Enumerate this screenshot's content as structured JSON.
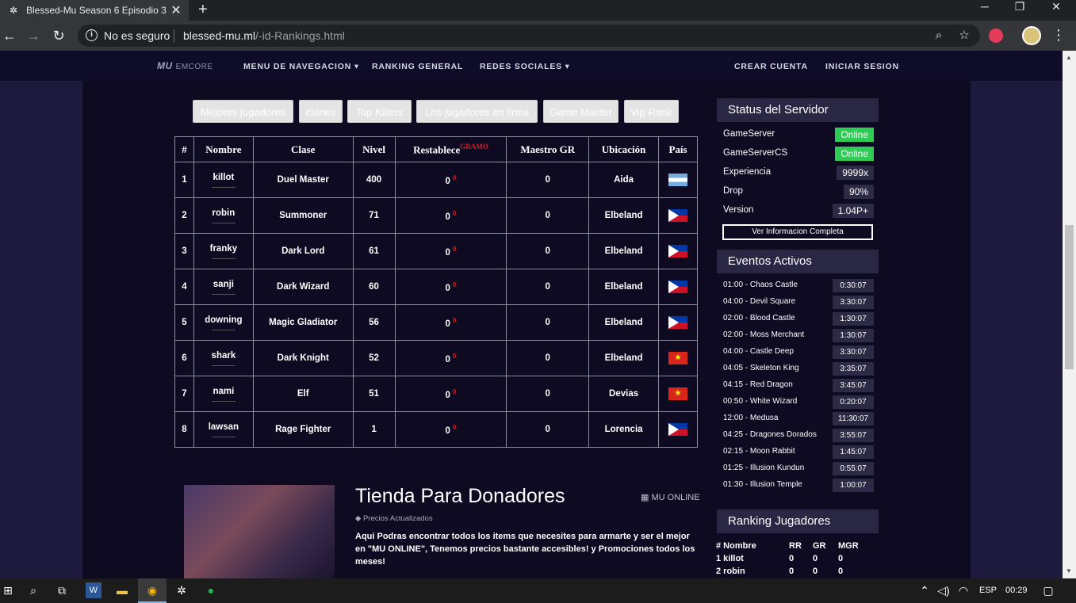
{
  "browser": {
    "tab_title": "Blessed-Mu Season 6 Episodio 3",
    "tab_close": "✕",
    "new_tab": "+",
    "insecure_label": "No es seguro",
    "url_domain": "blessed-mu.ml",
    "url_path": "/-id-Rankings.html"
  },
  "nav": {
    "logo_mark": "MU",
    "logo_text": "EMCORE",
    "menu": "MENU DE NAVEGACION",
    "ranking": "RANKING GENERAL",
    "social": "REDES SOCIALES",
    "create": "CREAR CUENTA",
    "login": "INICIAR SESION"
  },
  "ranking_buttons": [
    "Mejores jugadores",
    "clanes",
    "Top Killers",
    "Los jugadores en linea",
    "Game Master",
    "Vip Rank"
  ],
  "table": {
    "headers": [
      "#",
      "Nombre",
      "Clase",
      "Nivel",
      "Restablece",
      "Maestro GR",
      "Ubicación",
      "País"
    ],
    "reset_super": "GRAMO",
    "rows": [
      {
        "n": "1",
        "name": "killot",
        "clase": "Duel Master",
        "nivel": "400",
        "reset": "0",
        "reset_sup": "0",
        "mgr": "0",
        "loc": "Aida",
        "flag": "ar"
      },
      {
        "n": "2",
        "name": "robin",
        "clase": "Summoner",
        "nivel": "71",
        "reset": "0",
        "reset_sup": "0",
        "mgr": "0",
        "loc": "Elbeland",
        "flag": "ph"
      },
      {
        "n": "3",
        "name": "franky",
        "clase": "Dark Lord",
        "nivel": "61",
        "reset": "0",
        "reset_sup": "0",
        "mgr": "0",
        "loc": "Elbeland",
        "flag": "ph"
      },
      {
        "n": "4",
        "name": "sanji",
        "clase": "Dark Wizard",
        "nivel": "60",
        "reset": "0",
        "reset_sup": "0",
        "mgr": "0",
        "loc": "Elbeland",
        "flag": "ph"
      },
      {
        "n": "5",
        "name": "downing",
        "clase": "Magic Gladiator",
        "nivel": "56",
        "reset": "0",
        "reset_sup": "0",
        "mgr": "0",
        "loc": "Elbeland",
        "flag": "ph"
      },
      {
        "n": "6",
        "name": "shark",
        "clase": "Dark Knight",
        "nivel": "52",
        "reset": "0",
        "reset_sup": "0",
        "mgr": "0",
        "loc": "Elbeland",
        "flag": "vn"
      },
      {
        "n": "7",
        "name": "nami",
        "clase": "Elf",
        "nivel": "51",
        "reset": "0",
        "reset_sup": "0",
        "mgr": "0",
        "loc": "Devias",
        "flag": "vn"
      },
      {
        "n": "8",
        "name": "lawsan",
        "clase": "Rage Fighter",
        "nivel": "1",
        "reset": "0",
        "reset_sup": "0",
        "mgr": "0",
        "loc": "Lorencia",
        "flag": "ph"
      }
    ]
  },
  "shop": {
    "title": "Tienda Para Donadores",
    "category": "MU ONLINE",
    "tag": "Precios Actualizados",
    "text": "Aqui Podras encontrar todos los items que necesites para armarte y ser el mejor en \"MU ONLINE\", Tenemos precios bastante accesibles! y Promociones todos los meses!"
  },
  "status": {
    "title": "Status del Servidor",
    "rows": [
      {
        "label": "GameServer",
        "value": "Online",
        "online": true
      },
      {
        "label": "GameServerCS",
        "value": "Online",
        "online": true
      },
      {
        "label": "Experiencia",
        "value": "9999x",
        "online": false
      },
      {
        "label": "Drop",
        "value": "90%",
        "online": false
      },
      {
        "label": "Version",
        "value": "1.04P+",
        "online": false
      }
    ],
    "button": "Ver Informacion Completa"
  },
  "events": {
    "title": "Eventos Activos",
    "rows": [
      {
        "name": "01:00 - Chaos Castle",
        "time": "0:30:07"
      },
      {
        "name": "04:00 - Devil Square",
        "time": "3:30:07"
      },
      {
        "name": "02:00 - Blood Castle",
        "time": "1:30:07"
      },
      {
        "name": "02:00 - Moss Merchant",
        "time": "1:30:07"
      },
      {
        "name": "04:00 - Castle Deep",
        "time": "3:30:07"
      },
      {
        "name": "04:05 - Skeleton King",
        "time": "3:35:07"
      },
      {
        "name": "04:15 - Red Dragon",
        "time": "3:45:07"
      },
      {
        "name": "00:50 - White Wizard",
        "time": "0:20:07"
      },
      {
        "name": "12:00 - Medusa",
        "time": "11:30:07"
      },
      {
        "name": "04:25 - Dragones Dorados",
        "time": "3:55:07"
      },
      {
        "name": "02:15 - Moon Rabbit",
        "time": "1:45:07"
      },
      {
        "name": "01:25 - Illusion Kundun",
        "time": "0:55:07"
      },
      {
        "name": "01:30 - Illusion Temple",
        "time": "1:00:07"
      }
    ]
  },
  "ranking_players": {
    "title": "Ranking Jugadores",
    "headers": [
      "# Nombre",
      "RR",
      "GR",
      "MGR"
    ],
    "rows": [
      [
        "1 killot",
        "0",
        "0",
        "0"
      ],
      [
        "2 robin",
        "0",
        "0",
        "0"
      ]
    ]
  },
  "taskbar": {
    "lang": "ESP",
    "time": "00:29"
  }
}
